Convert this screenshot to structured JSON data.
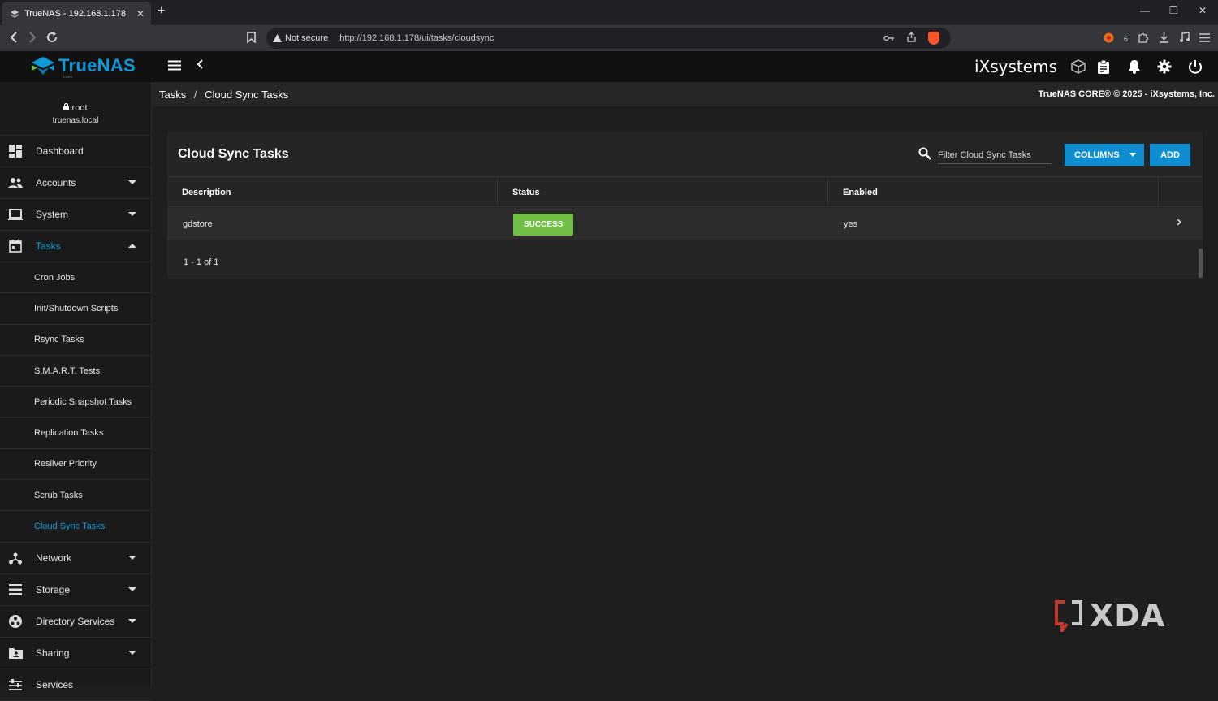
{
  "browser": {
    "tab_title": "TrueNAS - 192.168.1.178",
    "tab_close": "✕",
    "new_tab": "+",
    "security_label": "Not secure",
    "url": "http://192.168.1.178/ui/tasks/cloudsync",
    "window_controls": [
      "—",
      "❐",
      "✕"
    ],
    "extension_badge": "6"
  },
  "app": {
    "logo_text": "TrueNAS",
    "logo_sub": "CORE",
    "vendor_logo": "iXsystems",
    "header_icons": [
      "truecommand-icon",
      "clipboard-icon",
      "bell-icon",
      "gear-icon",
      "power-icon"
    ]
  },
  "user": {
    "name": "root",
    "host": "truenas.local"
  },
  "sidebar": {
    "items": [
      {
        "label": "Dashboard",
        "icon": "dashboard-icon"
      },
      {
        "label": "Accounts",
        "icon": "people-icon"
      },
      {
        "label": "System",
        "icon": "laptop-icon"
      },
      {
        "label": "Tasks",
        "icon": "calendar-icon"
      },
      {
        "label": "Network",
        "icon": "network-icon"
      },
      {
        "label": "Storage",
        "icon": "storage-icon"
      },
      {
        "label": "Directory Services",
        "icon": "directory-icon"
      },
      {
        "label": "Sharing",
        "icon": "folder-share-icon"
      },
      {
        "label": "Services",
        "icon": "services-icon"
      }
    ],
    "task_subitems": [
      "Cron Jobs",
      "Init/Shutdown Scripts",
      "Rsync Tasks",
      "S.M.A.R.T. Tests",
      "Periodic Snapshot Tasks",
      "Replication Tasks",
      "Resilver Priority",
      "Scrub Tasks",
      "Cloud Sync Tasks"
    ]
  },
  "breadcrumb": {
    "parent": "Tasks",
    "sep": "/",
    "current": "Cloud Sync Tasks"
  },
  "copyright": "TrueNAS CORE® © 2025 - iXsystems, Inc.",
  "card": {
    "title": "Cloud Sync Tasks",
    "filter_placeholder": "Filter Cloud Sync Tasks",
    "columns_button": "COLUMNS",
    "add_button": "ADD",
    "headers": [
      "Description",
      "Status",
      "Enabled"
    ],
    "rows": [
      {
        "description": "gdstore",
        "status": "SUCCESS",
        "enabled": "yes"
      }
    ],
    "pager": "1 - 1 of 1"
  },
  "colors": {
    "accent": "#0e9ad9",
    "button": "#0e8ed1",
    "success": "#71bf44",
    "background": "#1e1e1e"
  },
  "watermark": "XDA"
}
